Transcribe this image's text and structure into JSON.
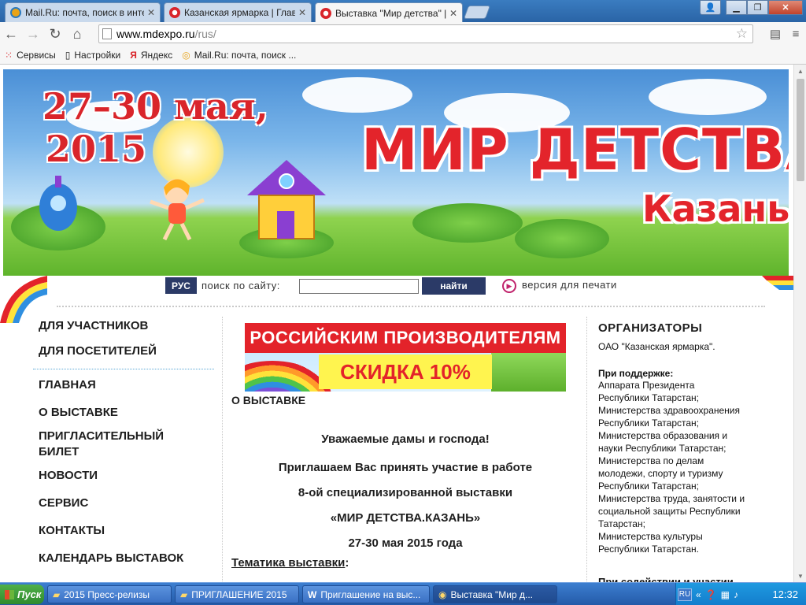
{
  "browser": {
    "tabs": [
      {
        "label": "Mail.Ru: почта, поиск в инте",
        "favicon_color": "#e8a317"
      },
      {
        "label": "Казанская ярмарка | Главн",
        "favicon_color": "#d9252b"
      },
      {
        "label": "Выставка \"Мир детства\" | К",
        "favicon_color": "#d9252b"
      }
    ],
    "url_host": "www.mdexpo.ru",
    "url_path": "/rus/",
    "bookmarks": [
      {
        "label": "Сервисы",
        "icon": "apps-grid-icon"
      },
      {
        "label": "Настройки",
        "icon": "page-icon"
      },
      {
        "label": "Яндекс",
        "icon": "yandex-icon"
      },
      {
        "label": "Mail.Ru: почта, поиск ...",
        "icon": "mailru-icon"
      }
    ]
  },
  "banner": {
    "dates_line1": "27–30 мая,",
    "dates_line2": "2015",
    "title": "МИР ДЕТСТВА.",
    "city": "Казань"
  },
  "search": {
    "lang_button": "РУС",
    "label": "поиск по сайту:",
    "input_value": "",
    "button": "найти",
    "print_link": "версия для печати"
  },
  "left_menu": {
    "top_items": [
      "ДЛЯ УЧАСТНИКОВ",
      "ДЛЯ ПОСЕТИТЕЛЕЙ"
    ],
    "items": [
      "ГЛАВНАЯ",
      "О ВЫСТАВКЕ",
      "ПРИГЛАСИТЕЛЬНЫЙ БИЛЕТ",
      "НОВОСТИ",
      "СЕРВИС",
      "КОНТАКТЫ",
      "КАЛЕНДАРЬ ВЫСТАВОК"
    ]
  },
  "promo": {
    "top": "РОССИЙСКИМ ПРОИЗВОДИТЕЛЯМ",
    "discount": "СКИДКА 10%"
  },
  "main": {
    "section_title": "О ВЫСТАВКЕ",
    "greeting": "Уважаемые дамы и господа!",
    "line1": "Приглашаем Вас принять участие в работе",
    "line2": "8-ой специализированной выставки",
    "line3": "«МИР ДЕТСТВА.КАЗАНЬ»",
    "line4": "27-30 мая 2015 года",
    "theme_link": "Тематика выставки",
    "theme_colon": ":"
  },
  "right": {
    "organizers_heading": "ОРГАНИЗАТОРЫ",
    "organizer": "ОАО \"Казанская ярмарка\".",
    "support_heading": "При поддержке:",
    "support_lines": [
      "Аппарата Президента",
      "Республики Татарстан;",
      "Министерства здравоохранения",
      "Республики Татарстан;",
      "Министерства образования и",
      "науки Республики Татарстан;",
      "Министерства по делам",
      "молодежи, спорту и туризму",
      "Республики Татарстан;",
      "Министерства труда, занятости и",
      "социальной защиты Республики",
      "Татарстан;",
      "Министерства культуры",
      "Республики Татарстан."
    ],
    "assistance_heading": "При содействии и участии"
  },
  "taskbar": {
    "start": "Пуск",
    "tasks": [
      {
        "label": "2015 Пресс-релизы",
        "icon": "folder-icon"
      },
      {
        "label": "ПРИГЛАШЕНИЕ 2015",
        "icon": "folder-icon"
      },
      {
        "label": "Приглашение на выс...",
        "icon": "word-icon"
      },
      {
        "label": "Выставка \"Мир д...",
        "icon": "chrome-icon"
      }
    ],
    "lang": "RU",
    "clock": "12:32"
  }
}
